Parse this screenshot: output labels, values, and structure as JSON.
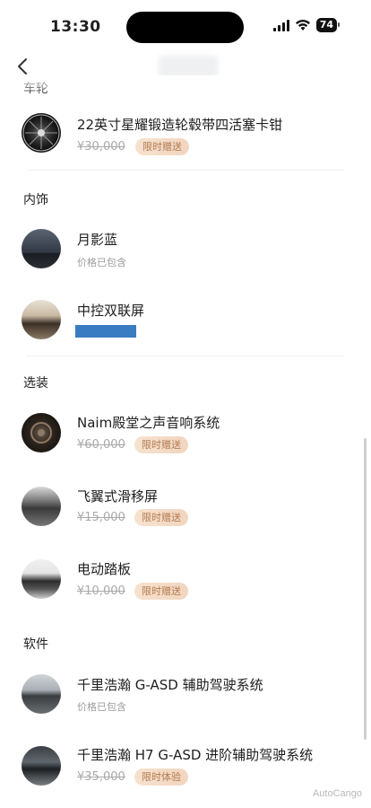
{
  "status_bar": {
    "time": "13:30",
    "battery": "74"
  },
  "nav": {
    "back_icon": "chevron-left-icon"
  },
  "sections": {
    "wheels": {
      "title": "车轮"
    },
    "interior": {
      "title": "内饰"
    },
    "options": {
      "title": "选装"
    },
    "software": {
      "title": "软件"
    }
  },
  "items": {
    "wheel": {
      "name": "22英寸星耀锻造轮毂带四活塞卡钳",
      "price": "¥30,000",
      "badge": "限时赠送"
    },
    "color": {
      "name": "月影蓝",
      "note": "价格已包含"
    },
    "screen": {
      "name": "中控双联屏"
    },
    "audio": {
      "name": "Naim殿堂之声音响系统",
      "price": "¥60,000",
      "badge": "限时赠送"
    },
    "sliding": {
      "name": "飞翼式滑移屏",
      "price": "¥15,000",
      "badge": "限时赠送"
    },
    "pedal": {
      "name": "电动踏板",
      "price": "¥10,000",
      "badge": "限时赠送"
    },
    "gasd": {
      "name": "千里浩瀚 G-ASD 辅助驾驶系统",
      "note": "价格已包含"
    },
    "h7": {
      "name": "千里浩瀚 H7 G-ASD 进阶辅助驾驶系统",
      "price": "¥35,000",
      "badge": "限时体验"
    }
  },
  "watermark": "AutoCango",
  "colors": {
    "badge_text": "#b27a4f",
    "badge_bg": "#f3dac5",
    "redaction": "#3a7cc1"
  }
}
